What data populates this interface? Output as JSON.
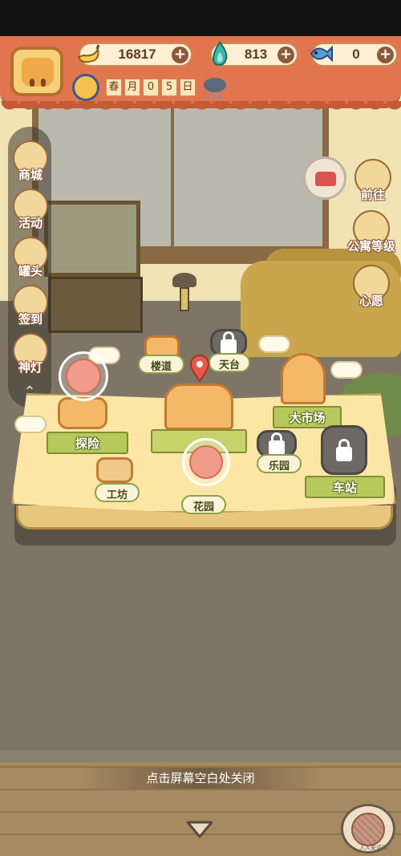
{
  "hud": {
    "currency": [
      {
        "name": "banana",
        "value": "16817",
        "plus": "+"
      },
      {
        "name": "blue-flame",
        "value": "813",
        "plus": "+"
      },
      {
        "name": "fish",
        "value": "0",
        "plus": "+"
      }
    ],
    "date": {
      "season": "春",
      "month_label": "月",
      "day_digits": [
        "0",
        "5"
      ],
      "day_label": "日"
    }
  },
  "left_sidebar": [
    {
      "label": "商城",
      "icon": "shop-icon"
    },
    {
      "label": "活动",
      "icon": "gift-icon"
    },
    {
      "label": "罐头",
      "icon": "can-icon"
    },
    {
      "label": "签到",
      "icon": "calendar-icon"
    },
    {
      "label": "神灯",
      "icon": "magic-lamp-icon"
    }
  ],
  "right_sidebar": [
    {
      "label": "前往",
      "icon": "map-pin-icon"
    },
    {
      "label": "公寓等级",
      "icon": "apartment-level-icon"
    },
    {
      "label": "心愿",
      "icon": "heart-wish-icon"
    }
  ],
  "map": {
    "locations": {
      "explore": "探险",
      "workshop": "工坊",
      "stairs": "楼道",
      "rooftop": "天台",
      "market": "大市场",
      "park": "乐园",
      "garden": "花园",
      "station": "车站"
    }
  },
  "footer": {
    "close_hint": "点击屏幕空白处关闭",
    "watermark": "人人安卓网"
  },
  "colors": {
    "hud_bg": "#e1764e",
    "banner_green": "#b7c85c",
    "book_paper": "#fbe6a6"
  }
}
